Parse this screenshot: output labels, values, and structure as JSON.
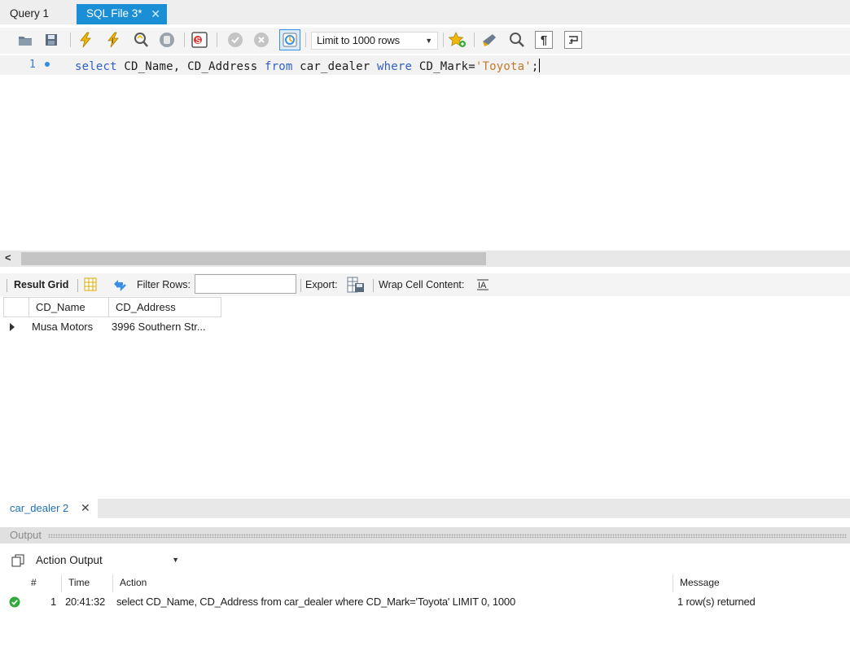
{
  "tabs": [
    {
      "label": "Query 1"
    },
    {
      "label": "SQL File 3*"
    }
  ],
  "toolbar": {
    "limit_label": "Limit to 1000 rows"
  },
  "editor": {
    "line_number": "1",
    "code_parts": [
      "select",
      " CD_Name, CD_Address ",
      "from",
      " car_dealer ",
      "where",
      " CD_Mark=",
      "'Toyota'",
      ";"
    ]
  },
  "result_toolbar": {
    "result_grid": "Result Grid",
    "filter_rows": "Filter Rows:",
    "export": "Export:",
    "wrap_cell": "Wrap Cell Content:"
  },
  "grid": {
    "columns": [
      "CD_Name",
      "CD_Address"
    ],
    "rows": [
      [
        "Musa Motors",
        "3996 Southern Str..."
      ]
    ]
  },
  "result_tab": {
    "label": "car_dealer 2"
  },
  "output": {
    "title": "Output",
    "select_value": "Action Output",
    "columns": [
      "#",
      "Time",
      "Action",
      "Message"
    ],
    "rows": [
      {
        "num": "1",
        "time": "20:41:32",
        "action": "select CD_Name, CD_Address from car_dealer where CD_Mark='Toyota' LIMIT 0, 1000",
        "message": "1 row(s) returned",
        "status": "success"
      }
    ]
  },
  "colors": {
    "active_tab": "#1b8fd6",
    "keyword": "#3060c8",
    "string": "#c27a2a",
    "success": "#2faa3c"
  }
}
